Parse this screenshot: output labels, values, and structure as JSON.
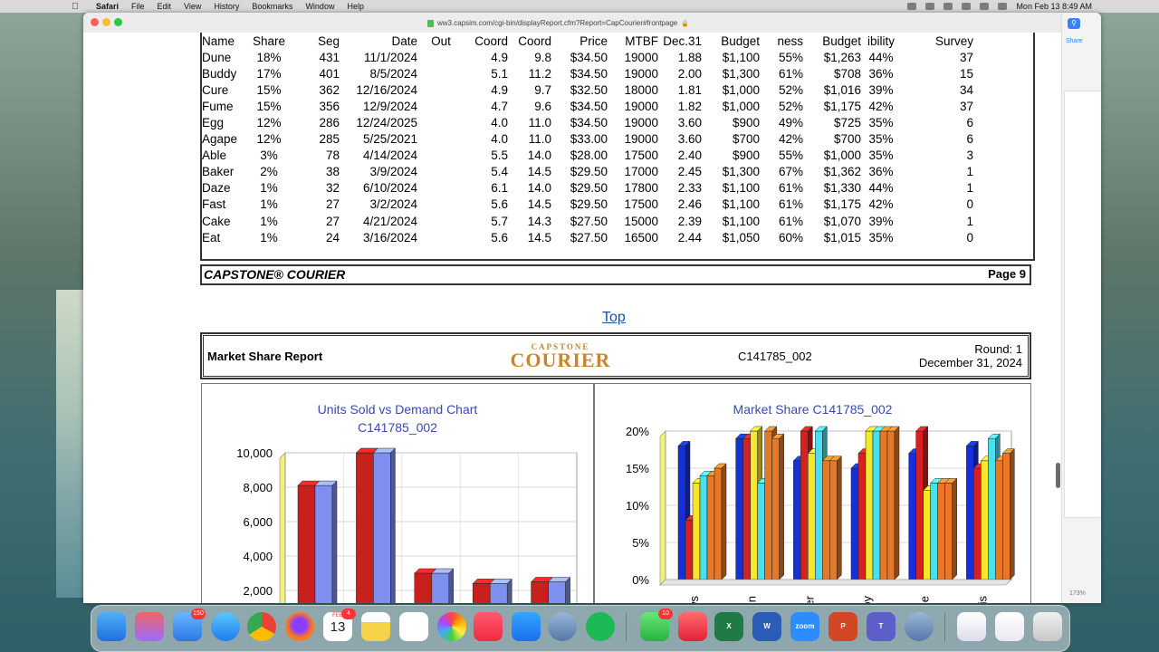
{
  "menubar": {
    "app": "Safari",
    "items": [
      "File",
      "Edit",
      "View",
      "History",
      "Bookmarks",
      "Window",
      "Help"
    ],
    "datetime": "Mon Feb 13  8:49 AM"
  },
  "browser": {
    "url": "ww3.capsim.com/cgi-bin/displayReport.cfm?Report=CapCourier#frontpage",
    "share_label": "Share",
    "zoom": "173%"
  },
  "table": {
    "headers": [
      "Name",
      "Share",
      "Seg",
      "Date",
      "Out",
      "Coord",
      "Coord",
      "Price",
      "MTBF",
      "Dec.31",
      "Budget",
      "ness",
      "Budget",
      "ibility",
      "Survey"
    ],
    "rows": [
      [
        "Dune",
        "18%",
        "431",
        "11/1/2024",
        "",
        "4.9",
        "9.8",
        "$34.50",
        "19000",
        "1.88",
        "$1,100",
        "55%",
        "$1,263",
        "44%",
        "37"
      ],
      [
        "Buddy",
        "17%",
        "401",
        "8/5/2024",
        "",
        "5.1",
        "11.2",
        "$34.50",
        "19000",
        "2.00",
        "$1,300",
        "61%",
        "$708",
        "36%",
        "15"
      ],
      [
        "Cure",
        "15%",
        "362",
        "12/16/2024",
        "",
        "4.9",
        "9.7",
        "$32.50",
        "18000",
        "1.81",
        "$1,000",
        "52%",
        "$1,016",
        "39%",
        "34"
      ],
      [
        "Fume",
        "15%",
        "356",
        "12/9/2024",
        "",
        "4.7",
        "9.6",
        "$34.50",
        "19000",
        "1.82",
        "$1,000",
        "52%",
        "$1,175",
        "42%",
        "37"
      ],
      [
        "Egg",
        "12%",
        "286",
        "12/24/2025",
        "",
        "4.0",
        "11.0",
        "$34.50",
        "19000",
        "3.60",
        "$900",
        "49%",
        "$725",
        "35%",
        "6"
      ],
      [
        "Agape",
        "12%",
        "285",
        "5/25/2021",
        "",
        "4.0",
        "11.0",
        "$33.00",
        "19000",
        "3.60",
        "$700",
        "42%",
        "$700",
        "35%",
        "6"
      ],
      [
        "Able",
        "3%",
        "78",
        "4/14/2024",
        "",
        "5.5",
        "14.0",
        "$28.00",
        "17500",
        "2.40",
        "$900",
        "55%",
        "$1,000",
        "35%",
        "3"
      ],
      [
        "Baker",
        "2%",
        "38",
        "3/9/2024",
        "",
        "5.4",
        "14.5",
        "$29.50",
        "17000",
        "2.45",
        "$1,300",
        "67%",
        "$1,362",
        "36%",
        "1"
      ],
      [
        "Daze",
        "1%",
        "32",
        "6/10/2024",
        "",
        "6.1",
        "14.0",
        "$29.50",
        "17800",
        "2.33",
        "$1,100",
        "61%",
        "$1,330",
        "44%",
        "1"
      ],
      [
        "Fast",
        "1%",
        "27",
        "3/2/2024",
        "",
        "5.6",
        "14.5",
        "$29.50",
        "17500",
        "2.46",
        "$1,100",
        "61%",
        "$1,175",
        "42%",
        "0"
      ],
      [
        "Cake",
        "1%",
        "27",
        "4/21/2024",
        "",
        "5.7",
        "14.3",
        "$27.50",
        "15000",
        "2.39",
        "$1,100",
        "61%",
        "$1,070",
        "39%",
        "1"
      ],
      [
        "Eat",
        "1%",
        "24",
        "3/16/2024",
        "",
        "5.6",
        "14.5",
        "$27.50",
        "16500",
        "2.44",
        "$1,050",
        "60%",
        "$1,015",
        "35%",
        "0"
      ]
    ]
  },
  "footer": {
    "left": "CAPSTONE® COURIER",
    "right": "Page 9"
  },
  "top_link": "Top",
  "report_header": {
    "title": "Market Share Report",
    "logo_small": "CAPSTONE",
    "logo_big": "COURIER",
    "code": "C141785_002",
    "round": "Round: 1",
    "date": "December 31, 2024"
  },
  "chart_data": [
    {
      "type": "bar",
      "title": "Units Sold vs Demand Chart",
      "subtitle": "C141785_002",
      "y_ticks": [
        "10,000",
        "8,000",
        "6,000",
        "4,000",
        "2,000",
        "0"
      ],
      "ylim": [
        0,
        10000
      ],
      "series": [
        {
          "values": [
            8100,
            10000,
            3000,
            2400,
            2500
          ]
        },
        {
          "values": [
            8100,
            10000,
            3000,
            2400,
            2500
          ]
        }
      ],
      "colors": [
        "#c8201c",
        "#7f8ff0"
      ]
    },
    {
      "type": "bar",
      "title": "Market Share  C141785_002",
      "y_ticks": [
        "20%",
        "15%",
        "10%",
        "5%",
        "0%"
      ],
      "ylim": [
        0,
        20
      ],
      "categories": [
        "rews",
        "dwin",
        "ester",
        "igby",
        "Erie",
        "erris"
      ],
      "series": [
        {
          "values": [
            18,
            19,
            16,
            15,
            17,
            18
          ]
        },
        {
          "values": [
            8,
            19,
            20,
            17,
            20,
            15
          ]
        },
        {
          "values": [
            13,
            20,
            17,
            20,
            12,
            16
          ]
        },
        {
          "values": [
            14,
            13,
            20,
            20,
            13,
            19
          ]
        },
        {
          "values": [
            14,
            20,
            16,
            20,
            13,
            16
          ]
        },
        {
          "values": [
            15,
            19,
            16,
            20,
            13,
            17
          ]
        }
      ],
      "colors": [
        "#1530d8",
        "#d82020",
        "#f5e82a",
        "#46e0ee",
        "#e87828",
        "#e87828"
      ]
    }
  ],
  "dock": {
    "mail_badge": "150",
    "calendar_month": "FEB",
    "calendar_day": "13",
    "calendar_badge": "4",
    "messages_badge": "10",
    "zoom_label": "zoom",
    "excel_label": "X",
    "word_label": "W",
    "ppt_label": "P",
    "teams_label": "T"
  }
}
